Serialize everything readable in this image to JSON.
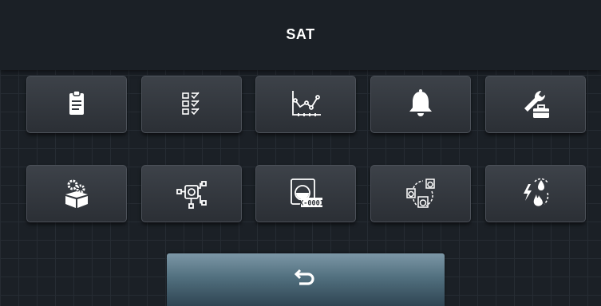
{
  "header": {
    "title": "SAT"
  },
  "tiles": [
    {
      "icon": "clipboard-icon"
    },
    {
      "icon": "checklist-icon"
    },
    {
      "icon": "line-chart-icon"
    },
    {
      "icon": "bell-icon"
    },
    {
      "icon": "wrench-toolbox-icon"
    },
    {
      "icon": "open-box-gears-icon"
    },
    {
      "icon": "network-nodes-icon"
    },
    {
      "icon": "washer-serial-icon",
      "label": "X-0001"
    },
    {
      "icon": "washer-group-icon"
    },
    {
      "icon": "lightning-water-fire-icon"
    }
  ],
  "footer": {
    "back_icon": "return-arrow-icon"
  },
  "colors": {
    "background": "#1b2026",
    "tile": "#363b42",
    "back_button": "#5a7787",
    "icon": "#ffffff"
  }
}
